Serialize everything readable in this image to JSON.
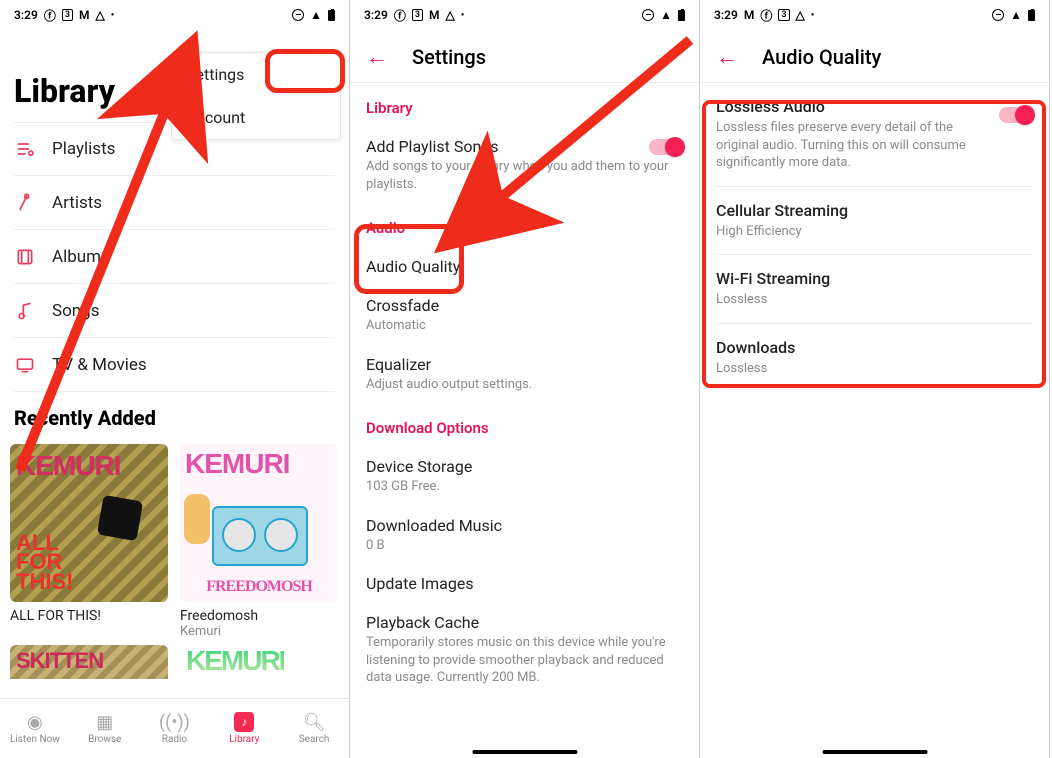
{
  "status": {
    "time": "3:29",
    "icons_left": [
      "facebook-icon",
      "box3-icon",
      "gmail-icon",
      "drive-icon",
      "dot-icon"
    ],
    "icons_right": [
      "dnd-icon",
      "wifi-icon",
      "battery-icon"
    ]
  },
  "screen1": {
    "title": "Library",
    "menu": {
      "settings": "Settings",
      "account": "Account"
    },
    "items": {
      "playlists": {
        "label": "Playlists"
      },
      "artists": {
        "label": "Artists"
      },
      "albums": {
        "label": "Albums"
      },
      "songs": {
        "label": "Songs"
      },
      "tv_movies": {
        "label": "TV & Movies"
      }
    },
    "recently_added": "Recently Added",
    "albums": [
      {
        "art_text": "KEMURI",
        "art_sub": "ALL\nFOR\nTHIS!",
        "title": "ALL FOR THIS!",
        "artist": ""
      },
      {
        "art_text": "KEMURI",
        "art_free": "FREEDOMOSH",
        "title": "Freedomosh",
        "artist": "Kemuri"
      }
    ],
    "albums_peek": [
      {
        "art_text": "SKITTEN"
      },
      {
        "art_text": "KEMURI"
      }
    ],
    "tabs": {
      "listen": "Listen Now",
      "browse": "Browse",
      "radio": "Radio",
      "library": "Library",
      "search": "Search"
    }
  },
  "screen2": {
    "header": "Settings",
    "library_section": "Library",
    "add_playlist": {
      "title": "Add Playlist Songs",
      "sub": "Add songs to your library when you add them to your playlists."
    },
    "audio_section": "Audio",
    "audio_quality": {
      "title": "Audio Quality"
    },
    "crossfade": {
      "title": "Crossfade",
      "sub": "Automatic"
    },
    "equalizer": {
      "title": "Equalizer",
      "sub": "Adjust audio output settings."
    },
    "download_section": "Download Options",
    "storage": {
      "title": "Device Storage",
      "sub": "103 GB Free."
    },
    "downloaded": {
      "title": "Downloaded Music",
      "sub": "0 B"
    },
    "update_images": {
      "title": "Update Images"
    },
    "playback_cache": {
      "title": "Playback Cache",
      "sub": "Temporarily stores music on this device while you're listening to provide smoother playback and reduced data usage. Currently 200 MB."
    }
  },
  "screen3": {
    "header": "Audio Quality",
    "lossless": {
      "title": "Lossless Audio",
      "sub": "Lossless files preserve every detail of the original audio. Turning this on will consume significantly more data."
    },
    "cellular": {
      "title": "Cellular Streaming",
      "sub": "High Efficiency"
    },
    "wifi": {
      "title": "Wi-Fi Streaming",
      "sub": "Lossless"
    },
    "downloads": {
      "title": "Downloads",
      "sub": "Lossless"
    }
  },
  "colors": {
    "accent": "#e6125a",
    "highlight": "#ef2b1b"
  }
}
